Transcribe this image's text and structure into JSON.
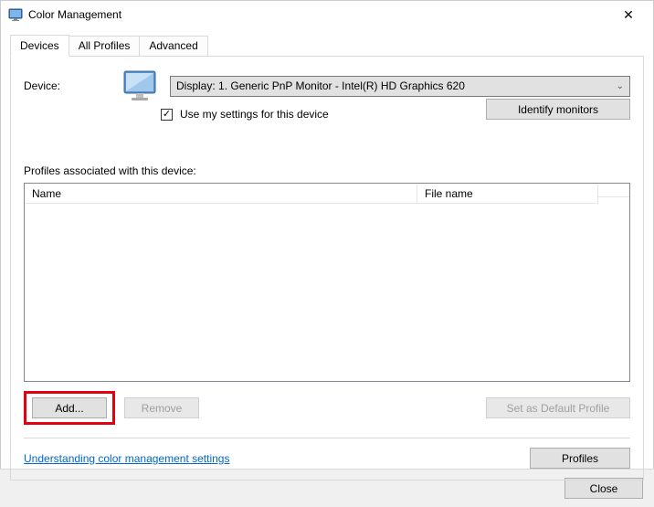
{
  "window": {
    "title": "Color Management",
    "close_glyph": "✕"
  },
  "tabs": {
    "devices": "Devices",
    "all_profiles": "All Profiles",
    "advanced": "Advanced"
  },
  "device": {
    "label": "Device:",
    "selected": "Display: 1. Generic PnP Monitor - Intel(R) HD Graphics 620",
    "use_my_settings": "Use my settings for this device",
    "identify": "Identify monitors"
  },
  "profiles": {
    "section_label": "Profiles associated with this device:",
    "col_name": "Name",
    "col_file": "File name"
  },
  "buttons": {
    "add": "Add...",
    "remove": "Remove",
    "set_default": "Set as Default Profile",
    "profiles": "Profiles",
    "close": "Close"
  },
  "link": {
    "understanding": "Understanding color management settings"
  }
}
